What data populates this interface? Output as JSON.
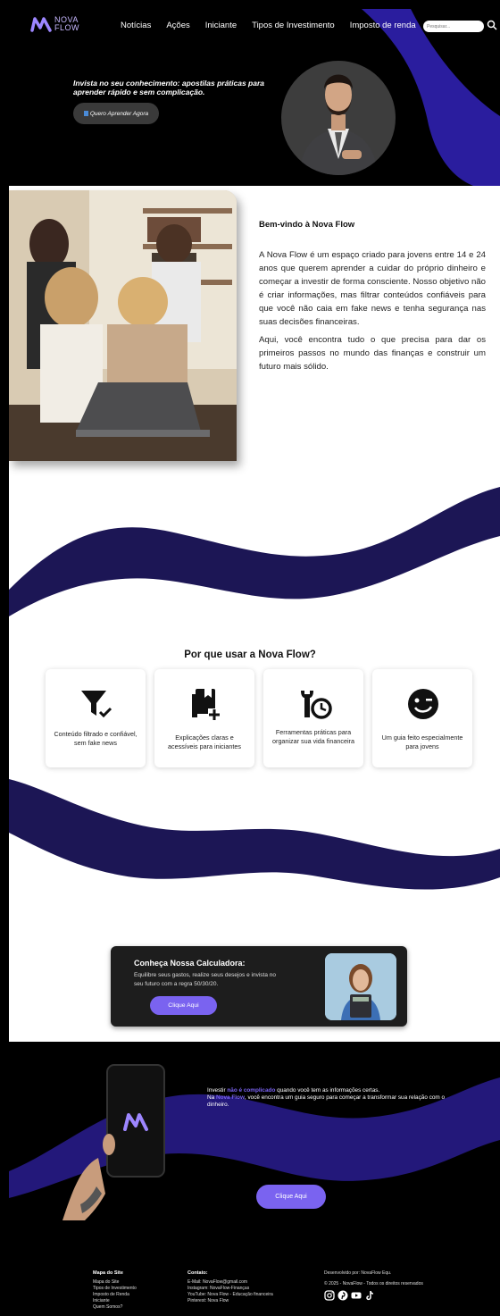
{
  "brand": {
    "name_line1": "NOVA",
    "name_line2": "FLOW"
  },
  "nav": {
    "items": [
      "Notícias",
      "Ações",
      "Iniciante",
      "Tipos de Investimento",
      "Imposto de renda"
    ],
    "search_placeholder": "Pesquisar..."
  },
  "hero": {
    "headline": "Invista no seu conhecimento: apostilas práticas para aprender rápido e sem complicação.",
    "cta": "Quero Aprender Agora"
  },
  "welcome": {
    "title": "Bem-vindo à Nova Flow",
    "p1": "A Nova Flow é um espaço criado para jovens entre 14 e 24 anos que querem aprender a cuidar do próprio dinheiro e começar a investir de forma consciente. Nosso objetivo não é criar informações, mas filtrar conteúdos confiáveis para que você não caia em fake news e tenha segurança nas suas decisões financeiras.",
    "p2": "Aqui, você encontra tudo o que precisa para dar os primeiros passos no mundo das finanças e construir um futuro mais sólido."
  },
  "why": {
    "title": "Por que usar a Nova Flow?",
    "cards": [
      {
        "icon": "filter-check-icon",
        "text": "Conteúdo filtrado e confiável, sem fake news"
      },
      {
        "icon": "book-add-icon",
        "text": "Explicações claras e acessíveis para iniciantes"
      },
      {
        "icon": "tool-clock-icon",
        "text": "Ferramentas práticas para organizar sua vida financeira"
      },
      {
        "icon": "wink-face-icon",
        "text": "Um guia feito especialmente para jovens"
      }
    ]
  },
  "calculator": {
    "title": "Conheça Nossa Calculadora:",
    "text": "Equilibre seus gastos, realize seus desejos e invista no seu futuro com a regra 50/30/20.",
    "cta": "Clique Aqui"
  },
  "promo": {
    "line1_pre": "Investir ",
    "line1_hl": "não é complicado",
    "line1_post": " quando você tem as informações certas.",
    "line2_pre": "Na ",
    "line2_hl": "Nova Flow",
    "line2_post": ", você encontra um guia seguro para começar a transformar sua relação com o dinheiro.",
    "cta": "Clique Aqui"
  },
  "footer": {
    "sitemap": {
      "title": "Mapa do Site",
      "items": [
        "Mapa do Site",
        "Tipos de Investimento",
        "Imposto de Renda",
        "Iniciante",
        "Quem Somos?"
      ]
    },
    "contact": {
      "title": "Contato:",
      "items": [
        "E-Mail: NovaFlow@gmail.com",
        "Instagram: NovaFlow-Finanças",
        "YouTube: Nova Flow - Educação financeira",
        "Pinterest: Nova Flow"
      ]
    },
    "credits": {
      "line1": "Desenvolvido por: NovaFlow Equ.",
      "line2": "© 2025 - NovaFlow - Todos os direitos reservados"
    },
    "socials": [
      "instagram-icon",
      "pinterest-icon",
      "youtube-icon",
      "tiktok-icon"
    ]
  },
  "colors": {
    "accent": "#7a63f0",
    "wave": "#1c1655",
    "dark": "#000000"
  }
}
